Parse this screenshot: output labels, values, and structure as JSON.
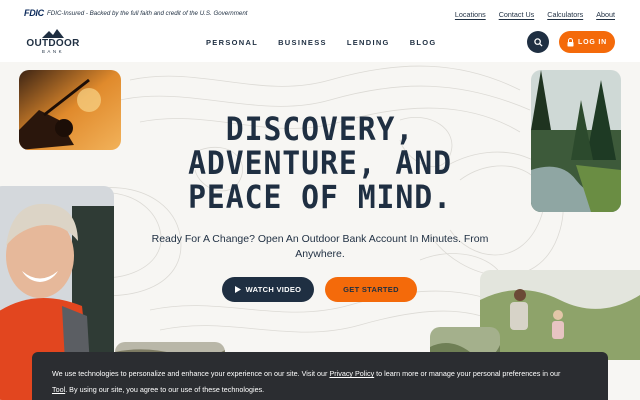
{
  "topbar": {
    "fdic_logo": "FDIC",
    "fdic_text": "FDIC-Insured - Backed by the full faith and credit of the U.S. Government",
    "links": [
      "Locations",
      "Contact Us",
      "Calculators",
      "About"
    ]
  },
  "nav": {
    "logo_word": "OUTDOOR",
    "logo_sub": "BANK",
    "items": [
      "PERSONAL",
      "BUSINESS",
      "LENDING",
      "BLOG"
    ],
    "search_icon": "search-icon",
    "login_label": "LOG IN",
    "login_icon": "lock-icon"
  },
  "hero": {
    "headline_line1": "DISCOVERY,",
    "headline_line2": "ADVENTURE, AND",
    "headline_line3": "PEACE OF MIND.",
    "subtitle": "Ready For A Change? Open An Outdoor Bank Account In Minutes. From Anywhere.",
    "watch_label": "WATCH VIDEO",
    "watch_icon": "play-icon",
    "start_label": "GET STARTED"
  },
  "cookie": {
    "text_before_privacy": "We use technologies to personalize and enhance your experience on our site. Visit our ",
    "privacy_link": "Privacy Policy",
    "text_mid": " to learn more or manage your personal preferences in our ",
    "tool_link": "Tool",
    "text_after": ". By using our site, you agree to our use of these technologies."
  },
  "colors": {
    "navy": "#1f2f42",
    "orange": "#f46a0a",
    "background": "#f7f6f3",
    "banner": "#2b2d31"
  }
}
